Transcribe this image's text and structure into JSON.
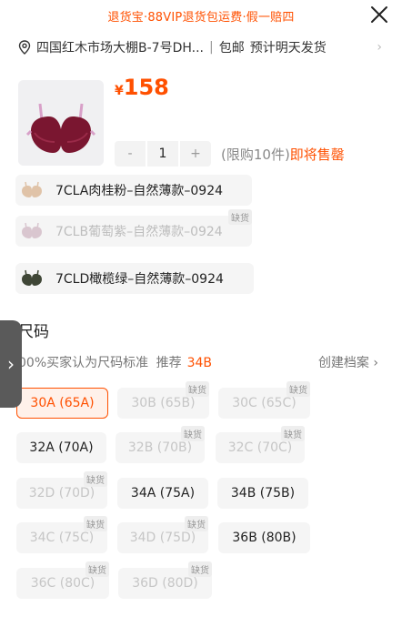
{
  "banner": {
    "text": "退货宝·88VIP退货包运费·假一赔四"
  },
  "address": {
    "text": "四国红木市场大棚B-7号DH...",
    "shipping": "包邮",
    "eta": "预计明天发货"
  },
  "product": {
    "currency": "¥",
    "price": "158",
    "minus": "-",
    "quantity": "1",
    "plus": "+",
    "limit_text": "(限购10件)",
    "soon_text": "即将售罄"
  },
  "variants": [
    {
      "label": "7CLA肉桂粉–自然薄款–0924",
      "disabled": false,
      "badge": ""
    },
    {
      "label": "7CLB葡萄紫–自然薄款–0924",
      "disabled": true,
      "badge": "缺货"
    },
    {
      "label": "7CLD橄榄绿–自然薄款–0924",
      "disabled": false,
      "badge": ""
    }
  ],
  "size_section": {
    "title": "尺码",
    "fit_text": "00%买家认为尺码标准",
    "recommend_label": "推荐",
    "recommend_value": "34B",
    "profile_link": "创建档案",
    "profile_arrow": "›"
  },
  "sizes": [
    {
      "label": "30A (65A)",
      "state": "selected",
      "badge": ""
    },
    {
      "label": "30B (65B)",
      "state": "disabled",
      "badge": "缺货"
    },
    {
      "label": "30C (65C)",
      "state": "disabled",
      "badge": "缺货"
    },
    {
      "label": "32A (70A)",
      "state": "normal",
      "badge": ""
    },
    {
      "label": "32B (70B)",
      "state": "disabled",
      "badge": "缺货"
    },
    {
      "label": "32C (70C)",
      "state": "disabled",
      "badge": "缺货"
    },
    {
      "label": "32D (70D)",
      "state": "disabled",
      "badge": "缺货"
    },
    {
      "label": "34A (75A)",
      "state": "normal",
      "badge": ""
    },
    {
      "label": "34B (75B)",
      "state": "normal",
      "badge": ""
    },
    {
      "label": "34C (75C)",
      "state": "disabled",
      "badge": "缺货"
    },
    {
      "label": "34D (75D)",
      "state": "disabled",
      "badge": "缺货"
    },
    {
      "label": "36B (80B)",
      "state": "normal",
      "badge": ""
    },
    {
      "label": "36C (80C)",
      "state": "disabled",
      "badge": "缺货"
    },
    {
      "label": "36D (80D)",
      "state": "disabled",
      "badge": "缺货"
    }
  ],
  "side_tab": {
    "glyph": "›"
  },
  "colors": {
    "accent": "#ff5000",
    "chip_bg": "#f5f5f5",
    "disabled_text": "#c6c6c6"
  }
}
